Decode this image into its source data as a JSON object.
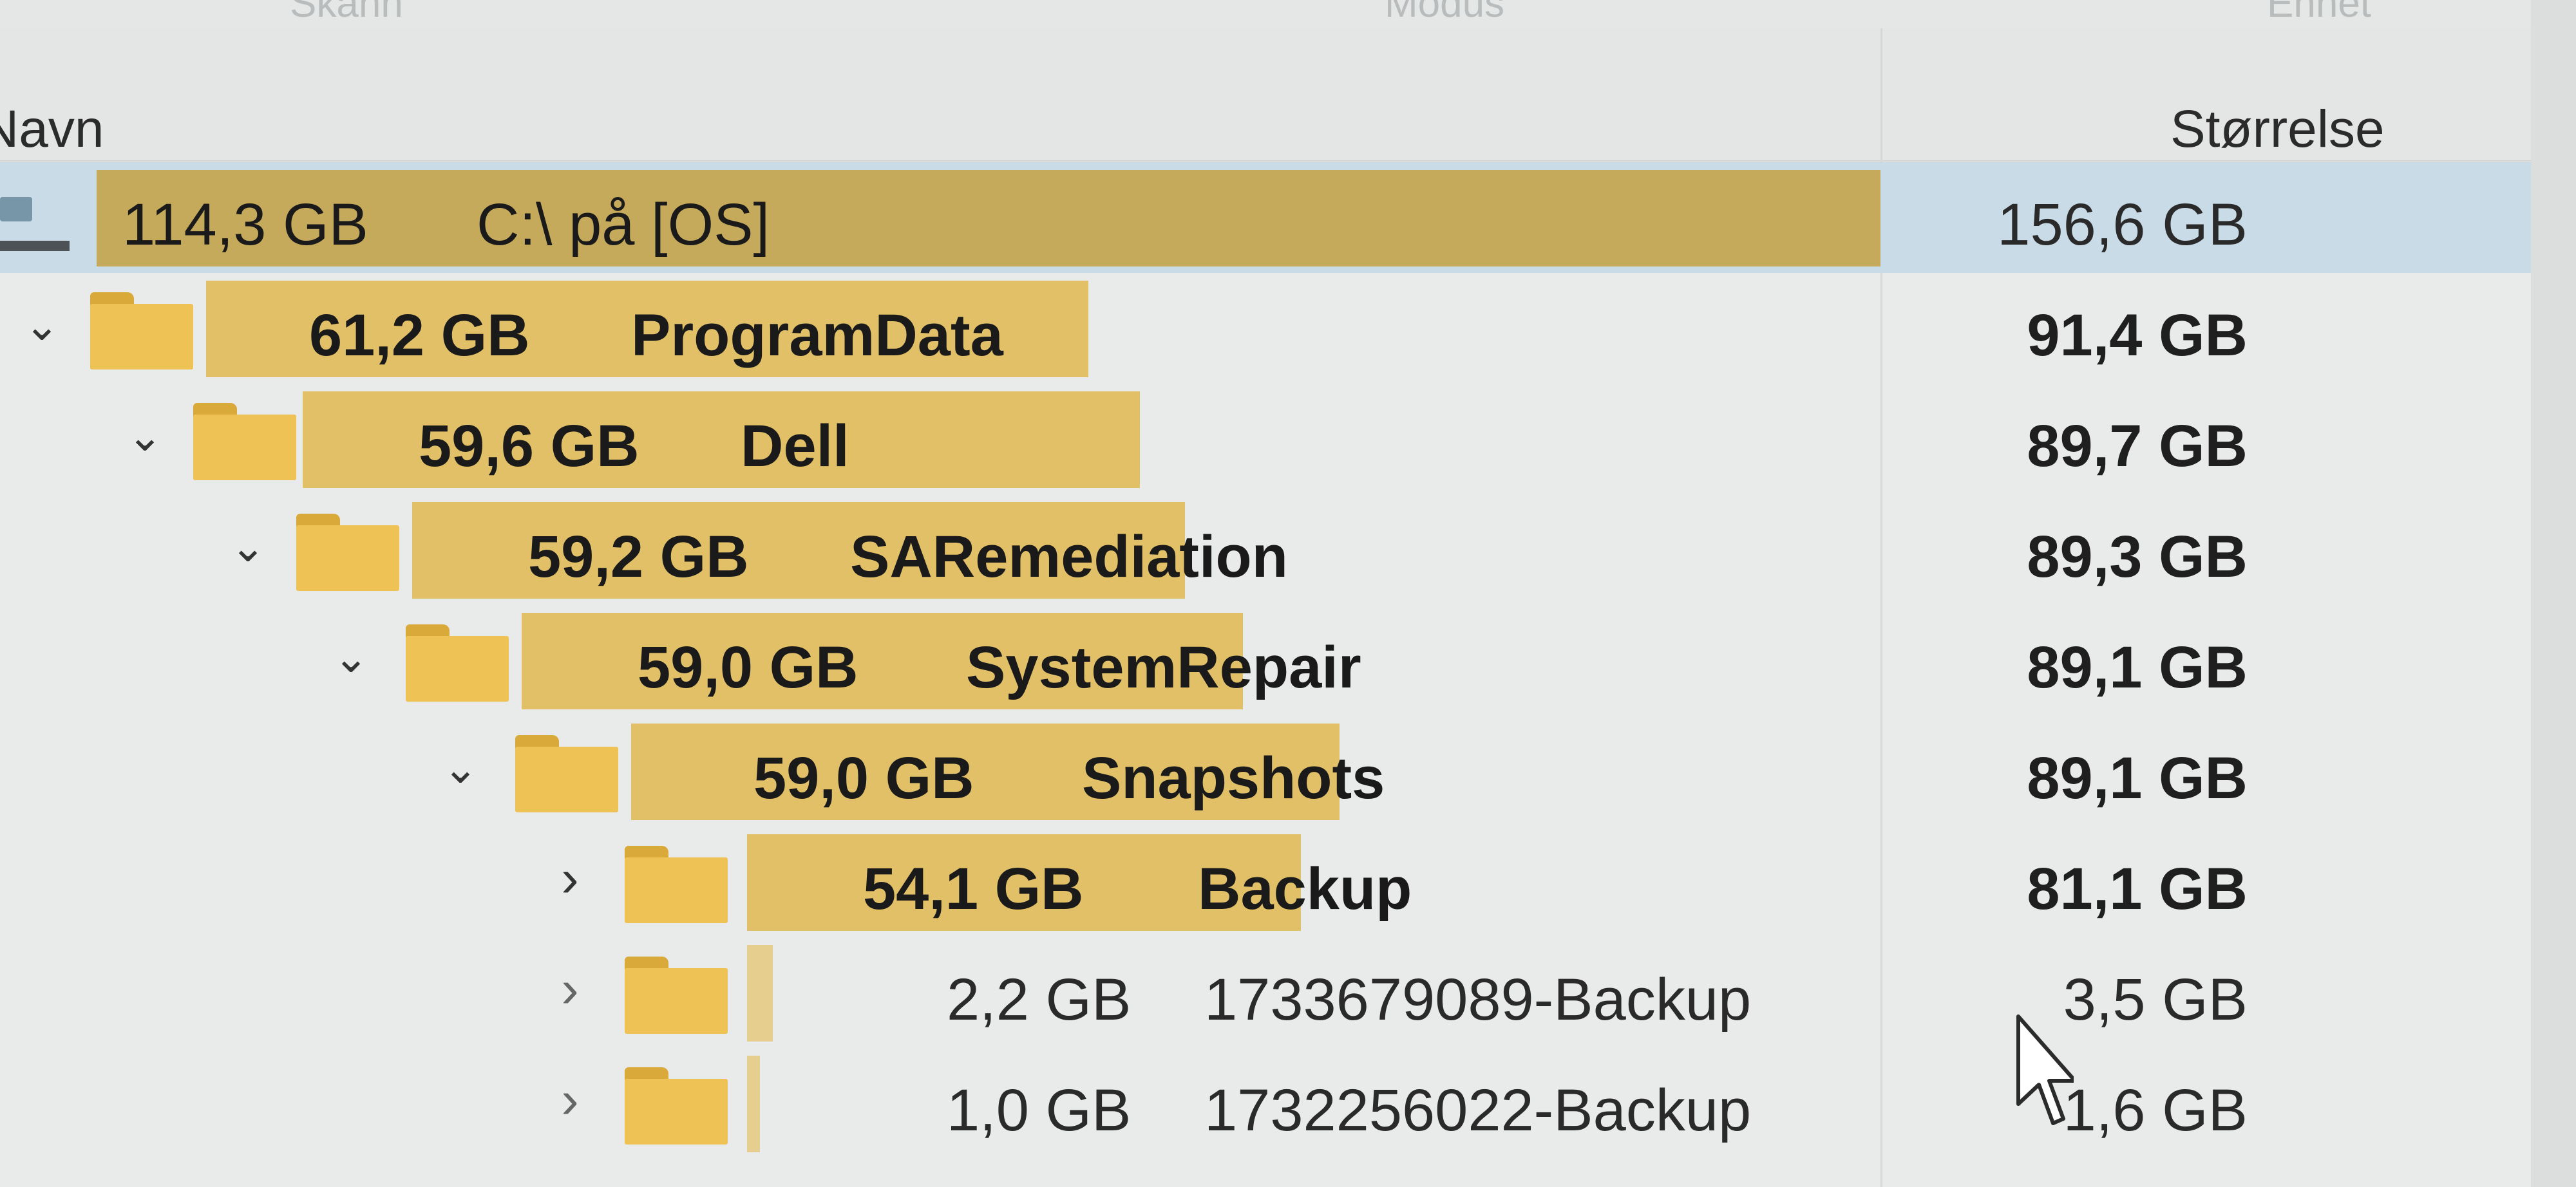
{
  "top": {
    "labels": [
      "Skann",
      "Modus",
      "Enhet"
    ]
  },
  "columns": {
    "name": "Navn",
    "size": "Størrelse"
  },
  "rows": [
    {
      "caret": "",
      "icon": "drive",
      "alloc": "114,3 GB",
      "name": "C:\\ på [OS]",
      "size": "156,6 GB",
      "selected": true
    },
    {
      "caret": "down",
      "icon": "folder",
      "alloc": "61,2 GB",
      "name": "ProgramData",
      "size": "91,4 GB"
    },
    {
      "caret": "down",
      "icon": "folder",
      "alloc": "59,6 GB",
      "name": "Dell",
      "size": "89,7 GB"
    },
    {
      "caret": "down",
      "icon": "folder",
      "alloc": "59,2 GB",
      "name": "SARemediation",
      "size": "89,3 GB"
    },
    {
      "caret": "down",
      "icon": "folder",
      "alloc": "59,0 GB",
      "name": "SystemRepair",
      "size": "89,1 GB"
    },
    {
      "caret": "down",
      "icon": "folder",
      "alloc": "59,0 GB",
      "name": "Snapshots",
      "size": "89,1 GB"
    },
    {
      "caret": "right",
      "icon": "folder",
      "alloc": "54,1 GB",
      "name": "Backup",
      "size": "81,1 GB"
    },
    {
      "caret": "right",
      "icon": "folder",
      "alloc": "2,2 GB",
      "name": "1733679089-Backup",
      "size": "3,5 GB"
    },
    {
      "caret": "right",
      "icon": "folder",
      "alloc": "1,0 GB",
      "name": "1732256022-Backup",
      "size": "1,6 GB"
    }
  ],
  "colors": {
    "bar": "#e2c068",
    "selected_row": "#c9dbe6",
    "folder": "#eec254"
  }
}
